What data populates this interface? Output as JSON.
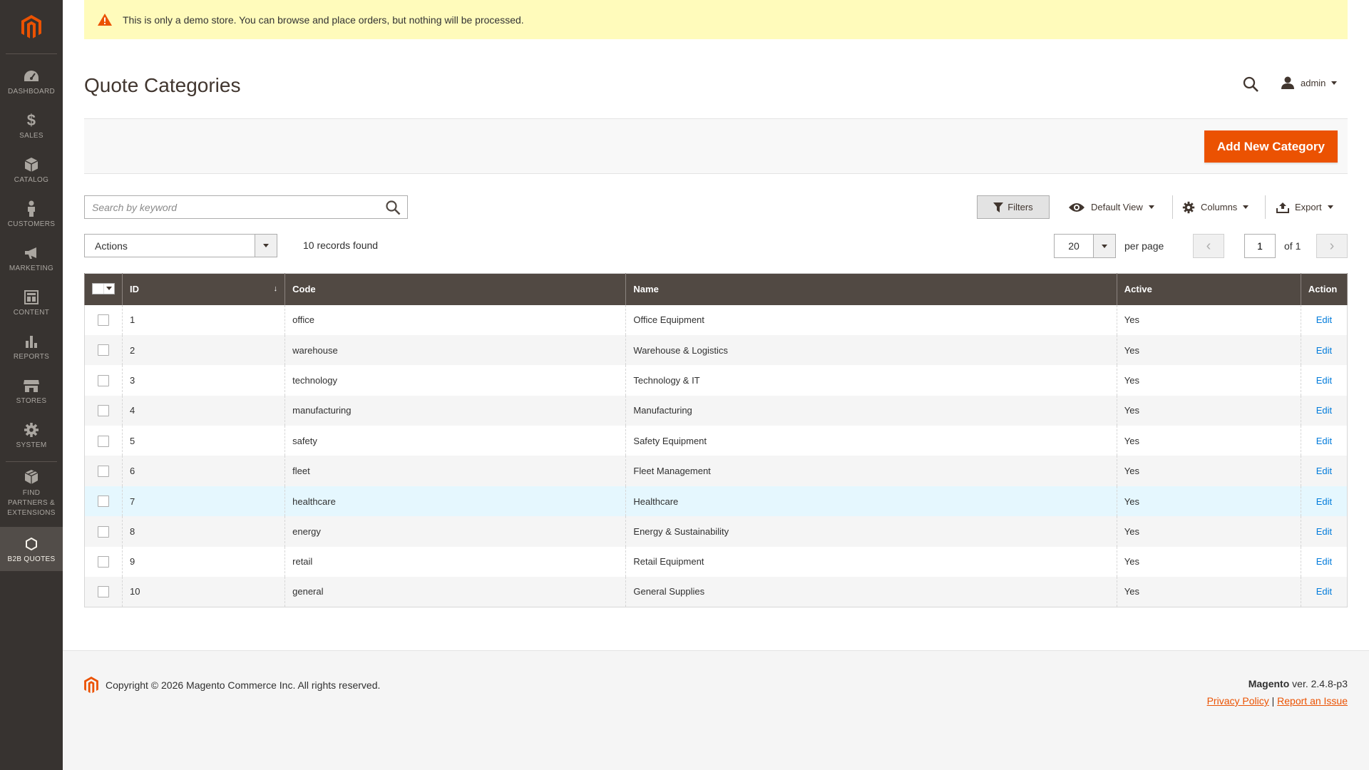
{
  "notice": {
    "text": "This is only a demo store. You can browse and place orders, but nothing will be processed."
  },
  "sidebar": {
    "items": [
      {
        "label": "DASHBOARD",
        "icon": "dashboard-icon"
      },
      {
        "label": "SALES",
        "icon": "dollar-icon"
      },
      {
        "label": "CATALOG",
        "icon": "box-icon"
      },
      {
        "label": "CUSTOMERS",
        "icon": "person-icon"
      },
      {
        "label": "MARKETING",
        "icon": "megaphone-icon"
      },
      {
        "label": "CONTENT",
        "icon": "layout-icon"
      },
      {
        "label": "REPORTS",
        "icon": "bar-chart-icon"
      },
      {
        "label": "STORES",
        "icon": "store-icon"
      },
      {
        "label": "SYSTEM",
        "icon": "gear-icon"
      }
    ],
    "partners": {
      "line1": "FIND",
      "line2": "PARTNERS &",
      "line3": "EXTENSIONS"
    },
    "active": {
      "label": "B2B QUOTES",
      "icon": "hexagon-icon"
    }
  },
  "header": {
    "title": "Quote Categories",
    "user": "admin"
  },
  "toolbar": {
    "add_button": "Add New Category",
    "search_placeholder": "Search by keyword",
    "filters": "Filters",
    "view": "Default View",
    "columns": "Columns",
    "export": "Export",
    "actions": "Actions",
    "records": "10 records found",
    "per_page_value": "20",
    "per_page_label": "per page",
    "page": "1",
    "page_of": "of 1"
  },
  "grid": {
    "columns": [
      "ID",
      "Code",
      "Name",
      "Active",
      "Action"
    ],
    "rows": [
      {
        "id": "1",
        "code": "office",
        "name": "Office Equipment",
        "active": "Yes",
        "action": "Edit"
      },
      {
        "id": "2",
        "code": "warehouse",
        "name": "Warehouse & Logistics",
        "active": "Yes",
        "action": "Edit"
      },
      {
        "id": "3",
        "code": "technology",
        "name": "Technology & IT",
        "active": "Yes",
        "action": "Edit"
      },
      {
        "id": "4",
        "code": "manufacturing",
        "name": "Manufacturing",
        "active": "Yes",
        "action": "Edit"
      },
      {
        "id": "5",
        "code": "safety",
        "name": "Safety Equipment",
        "active": "Yes",
        "action": "Edit"
      },
      {
        "id": "6",
        "code": "fleet",
        "name": "Fleet Management",
        "active": "Yes",
        "action": "Edit"
      },
      {
        "id": "7",
        "code": "healthcare",
        "name": "Healthcare",
        "active": "Yes",
        "action": "Edit"
      },
      {
        "id": "8",
        "code": "energy",
        "name": "Energy & Sustainability",
        "active": "Yes",
        "action": "Edit"
      },
      {
        "id": "9",
        "code": "retail",
        "name": "Retail Equipment",
        "active": "Yes",
        "action": "Edit"
      },
      {
        "id": "10",
        "code": "general",
        "name": "General Supplies",
        "active": "Yes",
        "action": "Edit"
      }
    ]
  },
  "footer": {
    "copyright": "Copyright © 2026 Magento Commerce Inc. All rights reserved.",
    "brand": "Magento",
    "version": "ver. 2.4.8-p3",
    "privacy": "Privacy Policy",
    "separator": "|",
    "report": "Report an Issue"
  },
  "colors": {
    "accent": "#eb5202",
    "sidebar": "#373330",
    "header_row": "#514943",
    "link": "#007bdb",
    "notice": "#fffbbb"
  }
}
